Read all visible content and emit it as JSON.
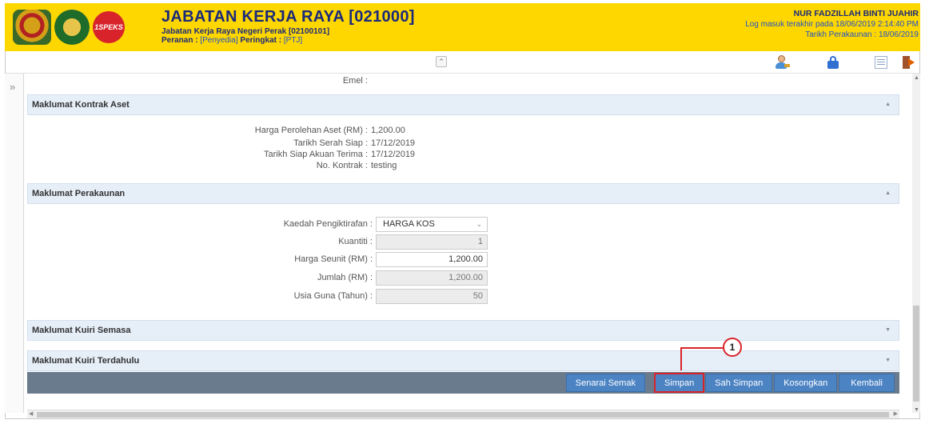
{
  "header": {
    "title": "JABATAN KERJA RAYA [021000]",
    "subtitle": "Jabatan Kerja Raya Negeri Perak [02100101]",
    "role_label": "Peranan :",
    "role_value": "[Penyedia]",
    "level_label": "Peringkat :",
    "level_value": "[PTJ]",
    "logo_text": "1SPEKS",
    "user_name": "NUR FADZILLAH BINTI JUAHIR",
    "last_login": "Log masuk terakhir pada 18/06/2019 2:14:40 PM",
    "account_date": "Tarikh Perakaunan : 18/06/2019"
  },
  "toolbar": {
    "collapse_glyph": "⌃",
    "icons": [
      "user-key-icon",
      "lock-icon",
      "list-icon",
      "exit-icon"
    ]
  },
  "side": {
    "toggle_glyph": "»"
  },
  "email_label": "Emel :",
  "sections": {
    "kontrak": {
      "title": "Maklumat Kontrak Aset",
      "rows": [
        {
          "label": "Harga Perolehan Aset (RM) :",
          "value": "1,200.00"
        },
        {
          "label": "Tarikh Serah Siap :",
          "value": "17/12/2019"
        },
        {
          "label": "Tarikh Siap Akuan Terima :",
          "value": "17/12/2019"
        },
        {
          "label": "No. Kontrak :",
          "value": "testing"
        }
      ]
    },
    "perakaunan": {
      "title": "Maklumat Perakaunan",
      "kaedah_label": "Kaedah Pengiktirafan :",
      "kaedah_value": "HARGA KOS",
      "kuantiti_label": "Kuantiti :",
      "kuantiti_value": "1",
      "harga_label": "Harga Seunit (RM) :",
      "harga_value": "1,200.00",
      "jumlah_label": "Jumlah (RM) :",
      "jumlah_value": "1,200.00",
      "usia_label": "Usia Guna (Tahun) :",
      "usia_value": "50"
    },
    "kuiri_semasa": {
      "title": "Maklumat Kuiri Semasa"
    },
    "kuiri_terdahulu": {
      "title": "Maklumat Kuiri Terdahulu"
    }
  },
  "actions": {
    "senarai_semak": "Senarai Semak",
    "simpan": "Simpan",
    "sah_simpan": "Sah Simpan",
    "kosongkan": "Kosongkan",
    "kembali": "Kembali"
  },
  "callout": {
    "number": "1",
    "color": "#d8232a"
  }
}
